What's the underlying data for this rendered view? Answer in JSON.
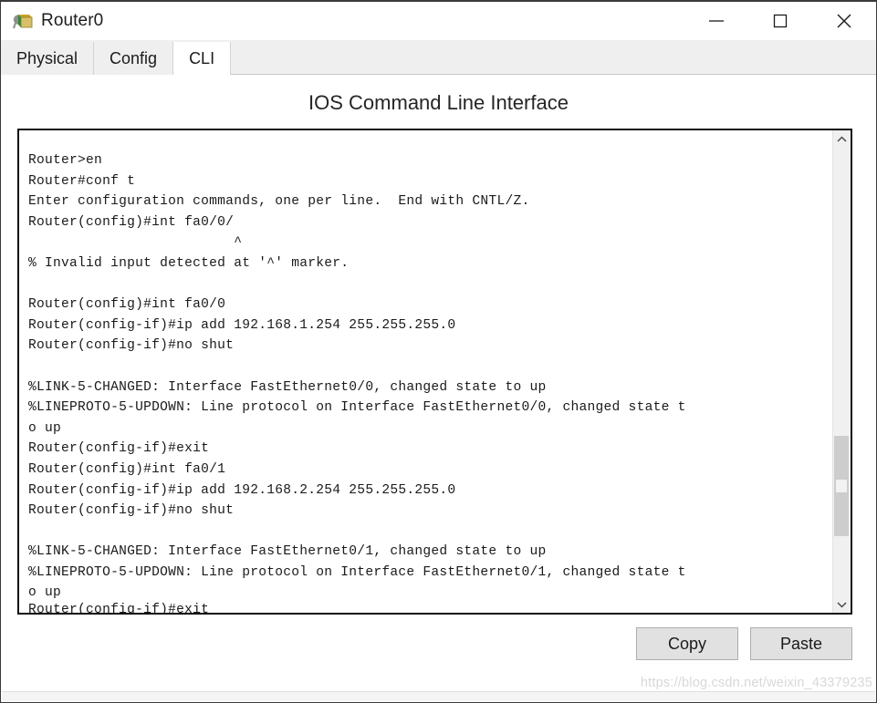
{
  "window": {
    "title": "Router0",
    "icon": "router-icon",
    "controls": [
      {
        "name": "minimize-button",
        "glyph": "minimize-icon"
      },
      {
        "name": "maximize-button",
        "glyph": "maximize-icon"
      },
      {
        "name": "close-button",
        "glyph": "close-icon"
      }
    ]
  },
  "tabs": [
    {
      "label": "Physical",
      "active": false
    },
    {
      "label": "Config",
      "active": false
    },
    {
      "label": "CLI",
      "active": true
    }
  ],
  "main": {
    "heading": "IOS Command Line Interface",
    "terminal_text": "Router>en\nRouter#conf t\nEnter configuration commands, one per line.  End with CNTL/Z.\nRouter(config)#int fa0/0/\n                         ^\n% Invalid input detected at '^' marker.\n\nRouter(config)#int fa0/0\nRouter(config-if)#ip add 192.168.1.254 255.255.255.0\nRouter(config-if)#no shut\n\n%LINK-5-CHANGED: Interface FastEthernet0/0, changed state to up\n%LINEPROTO-5-UPDOWN: Line protocol on Interface FastEthernet0/0, changed state t\no up\nRouter(config-if)#exit\nRouter(config)#int fa0/1\nRouter(config-if)#ip add 192.168.2.254 255.255.255.0\nRouter(config-if)#no shut\n\n%LINK-5-CHANGED: Interface FastEthernet0/1, changed state to up\n%LINEPROTO-5-UPDOWN: Line protocol on Interface FastEthernet0/1, changed state t\no up",
    "terminal_partial_line": "Router(config-if)#exit",
    "terminal_lines": [
      "Router>en",
      "Router#conf t",
      "Enter configuration commands, one per line.  End with CNTL/Z.",
      "Router(config)#int fa0/0/",
      "                         ^",
      "% Invalid input detected at '^' marker.",
      "",
      "Router(config)#int fa0/0",
      "Router(config-if)#ip add 192.168.1.254 255.255.255.0",
      "Router(config-if)#no shut",
      "",
      "%LINK-5-CHANGED: Interface FastEthernet0/0, changed state to up",
      "%LINEPROTO-5-UPDOWN: Line protocol on Interface FastEthernet0/0, changed state t",
      "o up",
      "Router(config-if)#exit",
      "Router(config)#int fa0/1",
      "Router(config-if)#ip add 192.168.2.254 255.255.255.0",
      "Router(config-if)#no shut",
      "",
      "%LINK-5-CHANGED: Interface FastEthernet0/1, changed state to up",
      "%LINEPROTO-5-UPDOWN: Line protocol on Interface FastEthernet0/1, changed state t",
      "o up"
    ]
  },
  "scrollbar": {
    "up_arrow": "chevron-up-icon",
    "down_arrow": "chevron-down-icon"
  },
  "footer": {
    "copy_label": "Copy",
    "paste_label": "Paste"
  },
  "watermark": "https://blog.csdn.net/weixin_43379235",
  "colors": {
    "terminal_text": "#1a1a1a",
    "tab_active_bg": "#ffffff",
    "tab_inactive_bg": "#efefef",
    "button_bg": "#e1e1e1",
    "scrollbar_thumb": "#cdcdcd"
  }
}
